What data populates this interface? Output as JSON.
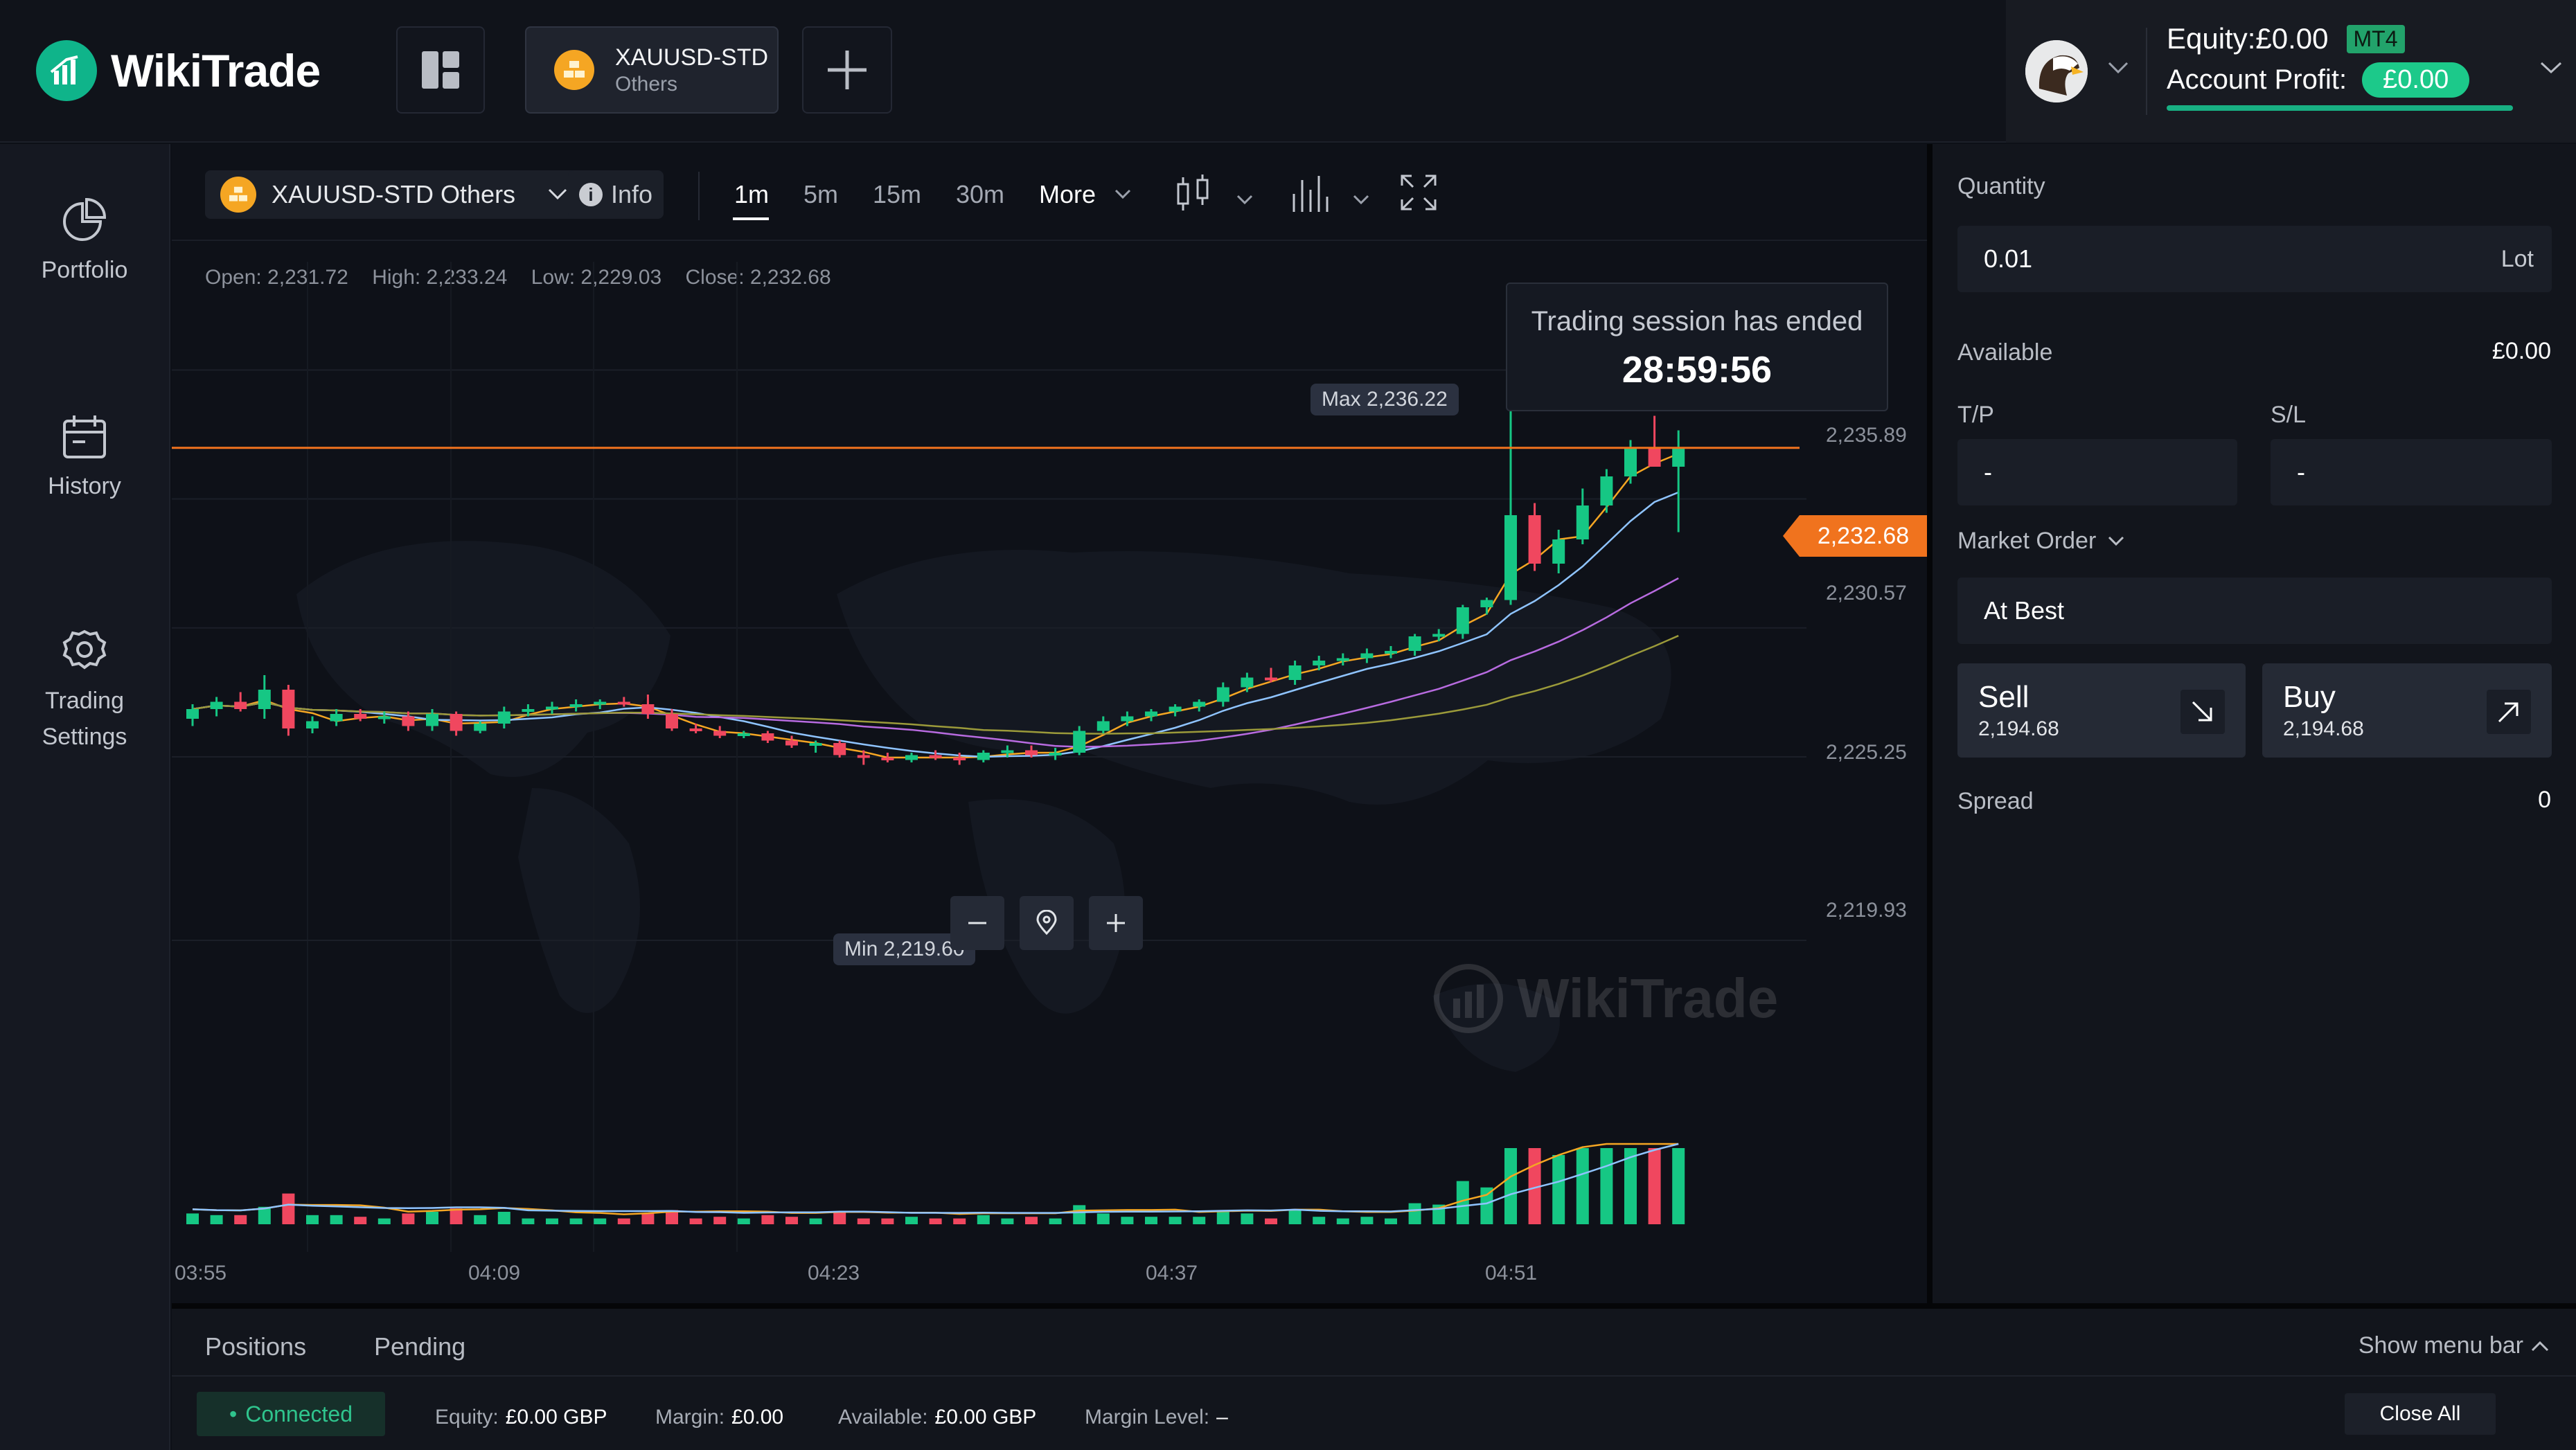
{
  "brand": {
    "name": "WikiTrade"
  },
  "header": {
    "symbol_tab": {
      "name": "XAUUSD-STD",
      "sub": "Others"
    },
    "equity_text": "Equity:£0.00",
    "platform_badge": "MT4",
    "profit_label": "Account Profit:",
    "profit_value": "£0.00"
  },
  "nav": {
    "portfolio": "Portfolio",
    "history": "History",
    "settings_line1": "Trading",
    "settings_line2": "Settings"
  },
  "toolbar": {
    "symbol_label": "XAUUSD-STD Others",
    "info_label": "Info",
    "timeframes": [
      "1m",
      "5m",
      "15m",
      "30m"
    ],
    "active_timeframe": "1m",
    "more_label": "More"
  },
  "ohlc": {
    "open": "Open: 2,231.72",
    "high": "High: 2,233.24",
    "low": "Low: 2,229.03",
    "close": "Close: 2,232.68"
  },
  "session": {
    "title": "Trading session has ended",
    "countdown": "28:59:56"
  },
  "markers": {
    "max": "Max 2,236.22",
    "min": "Min 2,219.60"
  },
  "current_price": "2,232.68",
  "watermark": "WikiTrade",
  "chart_data": {
    "type": "candlestick",
    "y_ticks": [
      "2,235.89",
      "2,230.57",
      "2,225.25",
      "2,219.93"
    ],
    "x_ticks": [
      "03:55",
      "04:09",
      "04:23",
      "04:37",
      "04:51"
    ],
    "y_range": [
      2217.5,
      2237.5
    ],
    "current_price": 2232.68,
    "max": 2236.22,
    "min": 2219.6,
    "colors": {
      "up": "#16c784",
      "down": "#f0475f",
      "price_line": "#f0731e"
    },
    "candles": [
      [
        2221.5,
        2222.1,
        2221.2,
        2221.9
      ],
      [
        2221.9,
        2222.4,
        2221.6,
        2222.2
      ],
      [
        2222.2,
        2222.6,
        2221.8,
        2221.9
      ],
      [
        2221.9,
        2223.3,
        2221.5,
        2222.7
      ],
      [
        2222.7,
        2222.9,
        2220.8,
        2221.1
      ],
      [
        2221.1,
        2221.6,
        2220.9,
        2221.4
      ],
      [
        2221.4,
        2221.9,
        2221.2,
        2221.7
      ],
      [
        2221.7,
        2221.9,
        2221.4,
        2221.5
      ],
      [
        2221.5,
        2221.8,
        2221.3,
        2221.6
      ],
      [
        2221.6,
        2221.8,
        2221.0,
        2221.2
      ],
      [
        2221.2,
        2221.9,
        2221.0,
        2221.7
      ],
      [
        2221.7,
        2221.8,
        2220.8,
        2221.0
      ],
      [
        2221.0,
        2221.4,
        2220.9,
        2221.3
      ],
      [
        2221.3,
        2222.0,
        2221.1,
        2221.8
      ],
      [
        2221.8,
        2222.1,
        2221.6,
        2221.9
      ],
      [
        2221.9,
        2222.2,
        2221.7,
        2222.0
      ],
      [
        2222.0,
        2222.3,
        2221.8,
        2222.1
      ],
      [
        2222.1,
        2222.3,
        2221.9,
        2222.2
      ],
      [
        2222.2,
        2222.4,
        2222.0,
        2222.1
      ],
      [
        2222.1,
        2222.5,
        2221.5,
        2221.7
      ],
      [
        2221.7,
        2221.9,
        2221.0,
        2221.1
      ],
      [
        2221.1,
        2221.3,
        2220.9,
        2221.0
      ],
      [
        2221.0,
        2221.2,
        2220.7,
        2220.8
      ],
      [
        2220.8,
        2221.0,
        2220.7,
        2220.9
      ],
      [
        2220.9,
        2221.0,
        2220.5,
        2220.6
      ],
      [
        2220.6,
        2220.8,
        2220.3,
        2220.4
      ],
      [
        2220.4,
        2220.6,
        2220.1,
        2220.5
      ],
      [
        2220.5,
        2220.6,
        2219.9,
        2220.0
      ],
      [
        2220.0,
        2220.2,
        2219.6,
        2219.9
      ],
      [
        2219.9,
        2220.1,
        2219.7,
        2219.8
      ],
      [
        2219.8,
        2220.1,
        2219.7,
        2220.0
      ],
      [
        2220.0,
        2220.2,
        2219.8,
        2219.9
      ],
      [
        2219.9,
        2220.1,
        2219.6,
        2219.8
      ],
      [
        2219.8,
        2220.2,
        2219.7,
        2220.1
      ],
      [
        2220.1,
        2220.4,
        2219.9,
        2220.2
      ],
      [
        2220.2,
        2220.4,
        2219.9,
        2220.0
      ],
      [
        2220.0,
        2220.3,
        2219.8,
        2220.1
      ],
      [
        2220.1,
        2221.2,
        2220.0,
        2221.0
      ],
      [
        2221.0,
        2221.6,
        2220.9,
        2221.4
      ],
      [
        2221.4,
        2221.8,
        2221.2,
        2221.6
      ],
      [
        2221.6,
        2221.9,
        2221.4,
        2221.8
      ],
      [
        2221.8,
        2222.1,
        2221.6,
        2222.0
      ],
      [
        2222.0,
        2222.3,
        2221.8,
        2222.2
      ],
      [
        2222.2,
        2223.0,
        2222.0,
        2222.8
      ],
      [
        2222.8,
        2223.4,
        2222.6,
        2223.2
      ],
      [
        2223.2,
        2223.6,
        2223.0,
        2223.1
      ],
      [
        2223.1,
        2223.9,
        2222.9,
        2223.7
      ],
      [
        2223.7,
        2224.1,
        2223.5,
        2223.9
      ],
      [
        2223.9,
        2224.2,
        2223.7,
        2224.0
      ],
      [
        2224.0,
        2224.4,
        2223.8,
        2224.2
      ],
      [
        2224.2,
        2224.5,
        2224.0,
        2224.3
      ],
      [
        2224.3,
        2225.0,
        2224.1,
        2224.9
      ],
      [
        2224.9,
        2225.2,
        2224.7,
        2225.0
      ],
      [
        2225.0,
        2226.2,
        2224.8,
        2226.1
      ],
      [
        2226.1,
        2226.5,
        2225.8,
        2226.4
      ],
      [
        2226.4,
        2236.2,
        2226.2,
        2229.9
      ],
      [
        2229.9,
        2230.4,
        2227.6,
        2227.9
      ],
      [
        2227.9,
        2229.3,
        2227.5,
        2228.9
      ],
      [
        2228.9,
        2231.0,
        2228.7,
        2230.3
      ],
      [
        2230.3,
        2231.8,
        2230.0,
        2231.5
      ],
      [
        2231.5,
        2233.0,
        2231.2,
        2232.7
      ],
      [
        2232.7,
        2234.0,
        2231.9,
        2231.9
      ],
      [
        2231.9,
        2233.4,
        2229.2,
        2232.7
      ]
    ]
  },
  "order": {
    "quantity_label": "Quantity",
    "quantity_value": "0.01",
    "quantity_unit": "Lot",
    "available_label": "Available",
    "available_value": "£0.00",
    "tp_label": "T/P",
    "sl_label": "S/L",
    "tp_value": "-",
    "sl_value": "-",
    "order_type": "Market Order",
    "price_mode": "At Best",
    "sell_label": "Sell",
    "sell_price": "2,194.68",
    "buy_label": "Buy",
    "buy_price": "2,194.68",
    "spread_label": "Spread",
    "spread_value": "0"
  },
  "bottom": {
    "tabs": [
      "Positions",
      "Pending"
    ],
    "show_menu": "Show menu bar",
    "connection": "Connected",
    "equity_label": "Equity:",
    "equity_value": "£0.00 GBP",
    "margin_label": "Margin:",
    "margin_value": "£0.00",
    "available_label": "Available:",
    "available_value": "£0.00 GBP",
    "margin_level_label": "Margin Level:",
    "margin_level_value": "–",
    "close_all": "Close All"
  }
}
